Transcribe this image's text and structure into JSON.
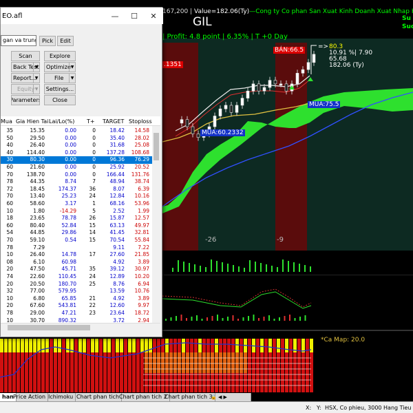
{
  "chart": {
    "title_prefix": "167,200 | ",
    "title_value": "Value=182.06(Ty)",
    "title_company": "—Cong ty Co phan San Xuat Kinh Doanh Xuat Nhap Khau Binh Thanh—",
    "right_top_1": "Su",
    "right_top_2": "Suc",
    "ticker": "GIL",
    "profit": "| Profit: 4.8 point | 6.35% | T +0 Day",
    "price_arrow": "=>",
    "price_current": "80.3",
    "price_change": "10.91 %| 7.90",
    "price_low": "65.68",
    "price_value": "182.06 (Ty)",
    "label_ban": "BÁN:66.5",
    "label_mua1": "MUA:75.5",
    "label_mua2": "MUA:60.2332",
    "label_left_red": ".1351",
    "axis_minus26": "-26",
    "axis_minus9": "-9",
    "ca_map": "*Ca Map: 20.0",
    "chart_data": {
      "type": "line",
      "ticker": "GIL",
      "series": [
        {
          "values": [
            62,
            60,
            58,
            57,
            58,
            60,
            63,
            65,
            66,
            64,
            66,
            68,
            70,
            72,
            70,
            71,
            73,
            72,
            72,
            70,
            72,
            75,
            76,
            78,
            80.3
          ]
        }
      ]
    },
    "colors": {
      "buy_zone": "#a01010",
      "cloud": "#2ee02e",
      "ma_yellow": "#e0c040",
      "ma_blue": "#3050ff"
    }
  },
  "dialog": {
    "title": "EO.afl",
    "combo_value": "gan va trung hai",
    "buttons": {
      "pick": "Pick",
      "edit": "Edit",
      "scan": "Scan",
      "explore": "Explore",
      "backtest": "Back Test",
      "optimize": "Optimize",
      "report": "Report...",
      "file": "File",
      "equity": "Equity",
      "settings": "Settings...",
      "parameters": "Parameters",
      "close": "Close"
    },
    "columns": [
      "Mua",
      "Gia Hien Tai",
      "Lai/Lo(%)",
      "T+",
      "TARGET",
      "Stoploss"
    ],
    "rows": [
      [
        "35",
        "15.35",
        "0.00",
        "0",
        "18.42",
        "14.58"
      ],
      [
        "50",
        "29.50",
        "0.00",
        "0",
        "35.40",
        "28.02"
      ],
      [
        "40",
        "26.40",
        "0.00",
        "0",
        "31.68",
        "25.08"
      ],
      [
        "40",
        "114.40",
        "0.00",
        "0",
        "137.28",
        "108.68"
      ],
      [
        "30",
        "80.30",
        "0.00",
        "0",
        "96.36",
        "76.29"
      ],
      [
        "60",
        "21.60",
        "0.00",
        "0",
        "25.92",
        "20.52"
      ],
      [
        "70",
        "138.70",
        "0.00",
        "0",
        "166.44",
        "131.76"
      ],
      [
        "78",
        "44.35",
        "8.74",
        "7",
        "48.94",
        "38.74"
      ],
      [
        "72",
        "18.45",
        "174.37",
        "36",
        "8.07",
        "6.39"
      ],
      [
        "70",
        "13.40",
        "25.23",
        "24",
        "12.84",
        "10.16"
      ],
      [
        "60",
        "58.60",
        "3.17",
        "1",
        "68.16",
        "53.96"
      ],
      [
        "10",
        "1.80",
        "-14.29",
        "5",
        "2.52",
        "1.99"
      ],
      [
        "18",
        "23.65",
        "78.78",
        "26",
        "15.87",
        "12.57"
      ],
      [
        "60",
        "80.40",
        "52.84",
        "15",
        "63.13",
        "49.97"
      ],
      [
        "54",
        "44.85",
        "29.86",
        "14",
        "41.45",
        "32.81"
      ],
      [
        "70",
        "59.10",
        "0.54",
        "15",
        "70.54",
        "55.84"
      ],
      [
        "78",
        "7.29",
        "",
        "",
        "9.11",
        "7.22"
      ],
      [
        "10",
        "26.40",
        "14.78",
        "17",
        "27.60",
        "21.85"
      ],
      [
        "08",
        "6.10",
        "60.98",
        "",
        "4.92",
        "3.89"
      ],
      [
        "20",
        "47.50",
        "45.71",
        "35",
        "39.12",
        "30.97"
      ],
      [
        "74",
        "22.60",
        "110.45",
        "24",
        "12.89",
        "10.20"
      ],
      [
        "20",
        "20.50",
        "180.70",
        "25",
        "8.76",
        "6.94"
      ],
      [
        "32",
        "77.00",
        "579.95",
        "",
        "13.59",
        "10.76"
      ],
      [
        "10",
        "6.80",
        "65.85",
        "21",
        "4.92",
        "3.89"
      ],
      [
        "20",
        "67.60",
        "543.81",
        "22",
        "12.60",
        "9.97"
      ],
      [
        "78",
        "29.00",
        "47.21",
        "23",
        "23.64",
        "18.72"
      ],
      [
        "10",
        "30.70",
        "890.32",
        "",
        "3.72",
        "2.94"
      ]
    ],
    "selected_row": 4
  },
  "tabs": [
    "han",
    "Price Action",
    "Ichimoku",
    "Chart phan tich",
    "Chart phan tich 2",
    "Chart phan tich 3"
  ],
  "status": {
    "x": "X:",
    "y": "Y:",
    "info": "HSX, Co phieu, 3000 Hang Tieu dung,"
  }
}
